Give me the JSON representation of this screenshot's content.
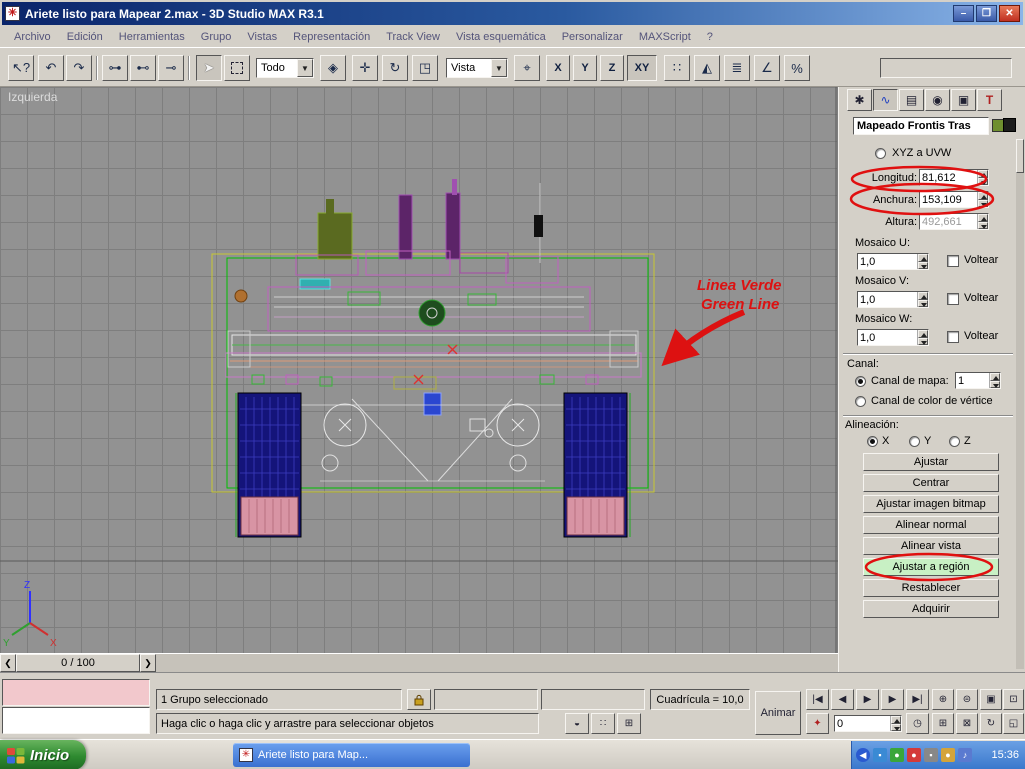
{
  "titlebar": {
    "title": "Ariete listo para Mapear 2.max - 3D Studio MAX R3.1"
  },
  "menubar": {
    "items": [
      "Archivo",
      "Edición",
      "Herramientas",
      "Grupo",
      "Vistas",
      "Representación",
      "Track View",
      "Vista esquemática",
      "Personalizar",
      "MAXScript",
      "?"
    ]
  },
  "toolbar": {
    "selection_filter": "Todo",
    "coord_system": "Vista",
    "axis_x": "X",
    "axis_y": "Y",
    "axis_z": "Z",
    "axis_xy": "XY"
  },
  "viewport": {
    "label": "Izquierda",
    "axis": {
      "x": "X",
      "y": "Y",
      "z": "Z"
    },
    "annotation_line1": "Linea Verde",
    "annotation_line2": "Green Line"
  },
  "panel": {
    "modifier_name": "Mapeado Frontis Tras",
    "xyz_uvw": "XYZ a UVW",
    "fields": {
      "longitud": {
        "label": "Longitud:",
        "value": "81,612"
      },
      "anchura": {
        "label": "Anchura:",
        "value": "153,109"
      },
      "altura": {
        "label": "Altura:",
        "value": "492,661"
      }
    },
    "mosaico": {
      "u_label": "Mosaico U:",
      "v_label": "Mosaico V:",
      "w_label": "Mosaico W:",
      "value": "1,0",
      "voltear": "Voltear"
    },
    "canal": {
      "label": "Canal:",
      "mapa_label": "Canal de mapa:",
      "mapa_value": "1",
      "vertice_label": "Canal de color de vértice"
    },
    "alineacion": {
      "label": "Alineación:",
      "x": "X",
      "y": "Y",
      "z": "Z"
    },
    "buttons": [
      "Ajustar",
      "Centrar",
      "Ajustar imagen bitmap",
      "Alinear normal",
      "Alinear vista",
      "Ajustar a región",
      "Restablecer",
      "Adquirir"
    ]
  },
  "timeline": {
    "frame": "0 / 100"
  },
  "statusbar": {
    "selection": "1 Grupo seleccionado",
    "prompt": "Haga clic o haga clic y arrastre para seleccionar objetos",
    "grid": "Cuadrícula = 10,0",
    "animar": "Animar",
    "frame": "0"
  },
  "taskbar": {
    "start": "Inicio",
    "task": "Ariete listo para Map...",
    "time": "15:36"
  },
  "icons": {
    "app": "✳",
    "minimize": "–",
    "maximize": "❐",
    "close": "✕",
    "help": "↖?",
    "undo": "↶",
    "redo": "↷",
    "link": "⊶",
    "unlink": "⊷",
    "bind_spacewarp": "⊸",
    "select_arrow": "➤",
    "crossing": "◈",
    "move": "✛",
    "rotate": "↻",
    "scale": "◳",
    "pivot": "⌖",
    "snap": "∷",
    "angle_snap": "∠",
    "percent_snap": "%",
    "mirror": "◭",
    "align": "≣",
    "dropdown": "▼",
    "tab_create": "✱",
    "tab_modify": "∿",
    "tab_hierarchy": "▤",
    "tab_motion": "◉",
    "tab_display": "▣",
    "tab_utilities": "T",
    "timeline_prev": "❮",
    "timeline_next": "❯",
    "play_start": "|◀",
    "play_prev": "◀",
    "play": "▶",
    "play_next": "▶",
    "play_end": "▶|",
    "key_toggle": "✦",
    "time_config": "◷",
    "status_circle": "◒",
    "status_dots": "∷",
    "status_window": "⊞",
    "zoom": "⊕",
    "zoom_all": "⊜",
    "zoom_extents": "▣",
    "zoom_extents_all": "⊡",
    "zoom_region": "⊞",
    "pan": "⊠",
    "arc_rotate": "↻",
    "minmax": "◱",
    "tray_chevron": "◀",
    "tray_note": "♪",
    "tray_dot": "●",
    "tray_sq": "▪"
  },
  "colors": {
    "annotation_red": "#dd1111",
    "region_button_green": "#c8f0c4",
    "gizmo_green": "#00c000",
    "selection_yellow": "#c8c832",
    "viewport_gray": "#929292"
  }
}
